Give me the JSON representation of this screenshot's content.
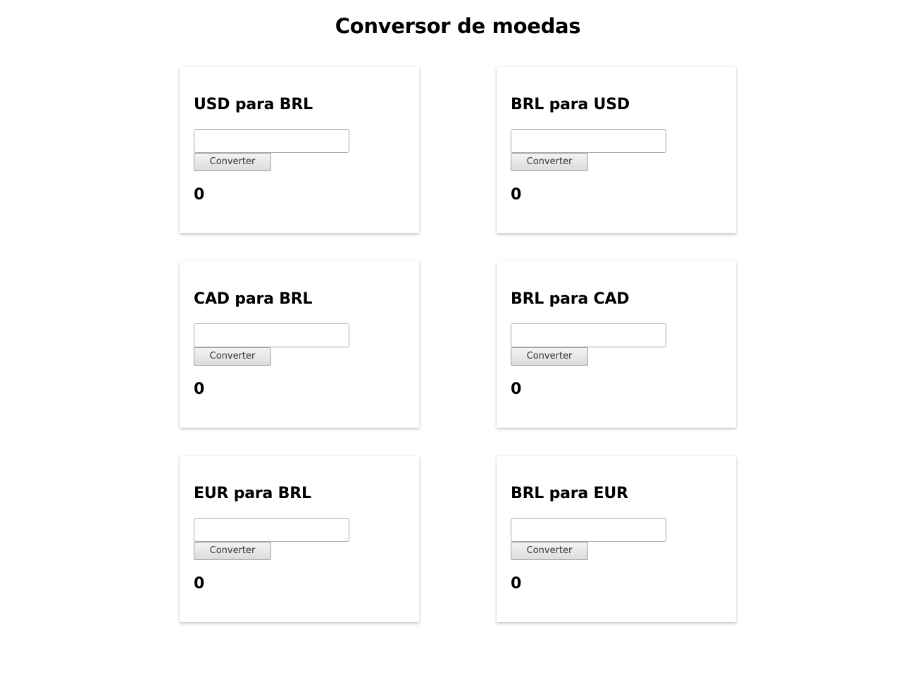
{
  "page": {
    "title": "Conversor de moedas"
  },
  "converters": [
    {
      "title": "USD para BRL",
      "input_value": "",
      "button_label": "Converter",
      "result": "0"
    },
    {
      "title": "BRL para USD",
      "input_value": "",
      "button_label": "Converter",
      "result": "0"
    },
    {
      "title": "CAD para BRL",
      "input_value": "",
      "button_label": "Converter",
      "result": "0"
    },
    {
      "title": "BRL para CAD",
      "input_value": "",
      "button_label": "Converter",
      "result": "0"
    },
    {
      "title": "EUR para BRL",
      "input_value": "",
      "button_label": "Converter",
      "result": "0"
    },
    {
      "title": "BRL para EUR",
      "input_value": "",
      "button_label": "Converter",
      "result": "0"
    }
  ]
}
